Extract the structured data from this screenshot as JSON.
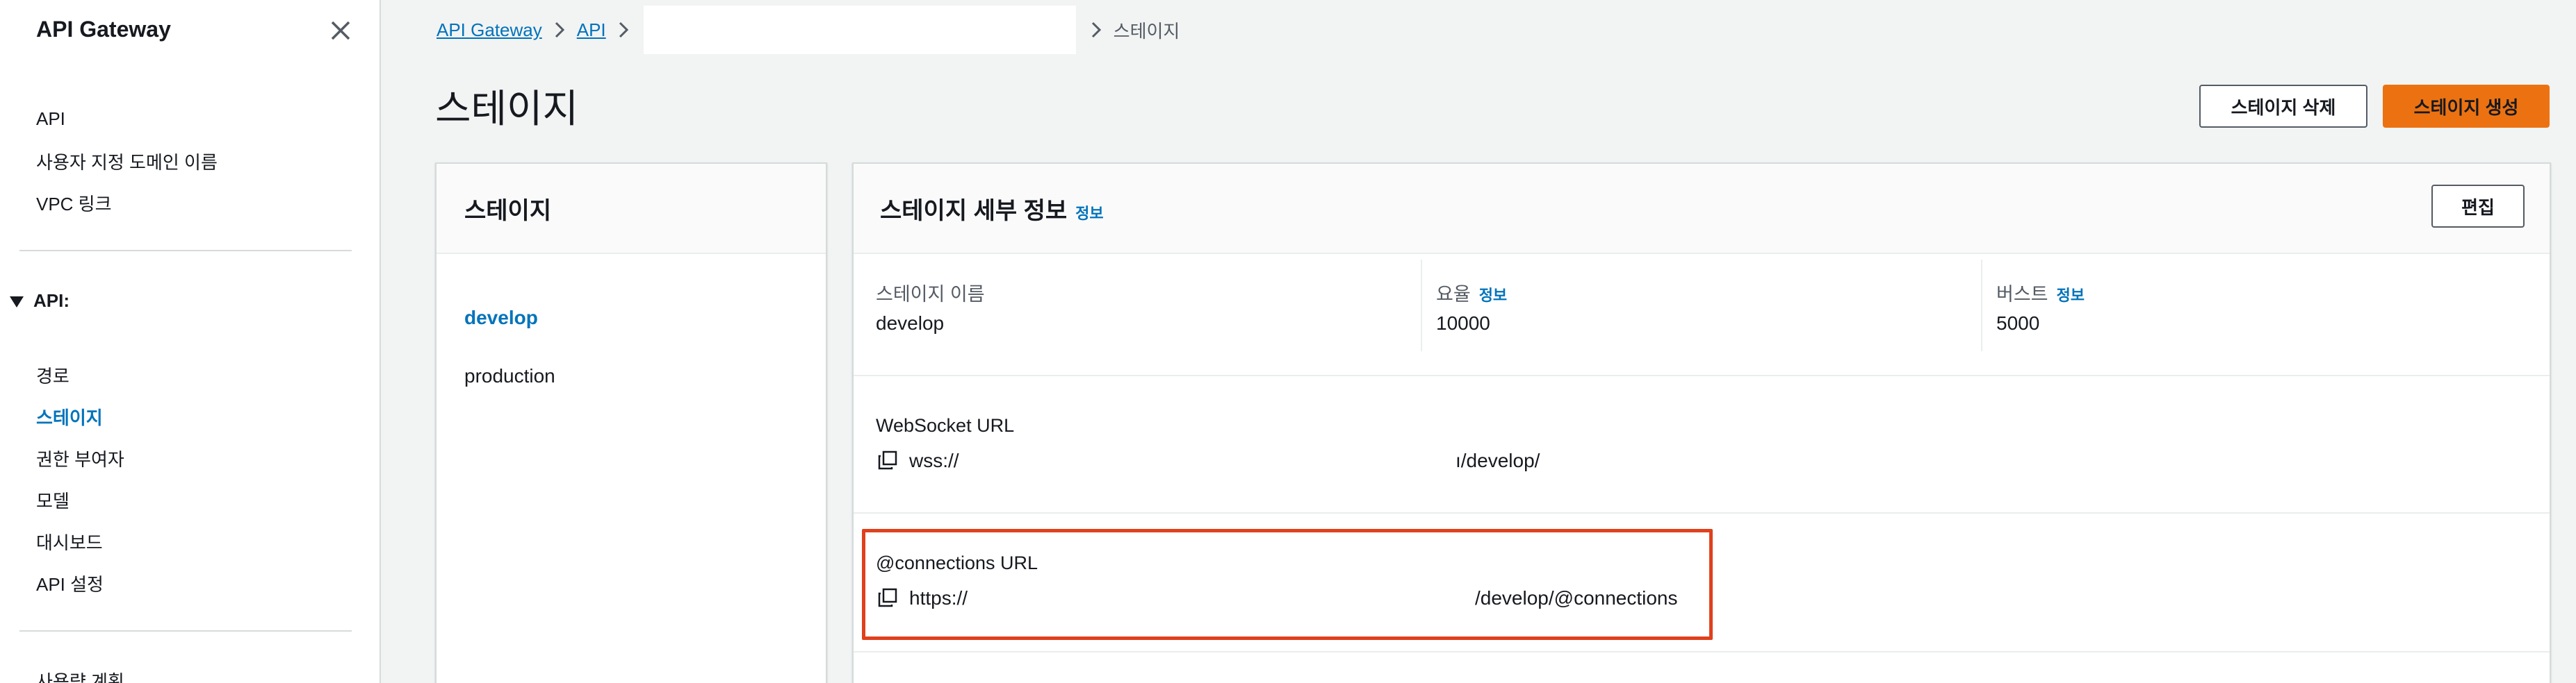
{
  "sidebar": {
    "title": "API Gateway",
    "top_links": [
      "API",
      "사용자 지정 도메인 이름",
      "VPC 링크"
    ],
    "section_label": "API:",
    "section_links": [
      "경로",
      "스테이지",
      "권한 부여자",
      "모델",
      "대시보드",
      "API 설정"
    ],
    "active_link": "스테이지",
    "cut_link": "사용량 계획"
  },
  "breadcrumb": {
    "items": [
      "API Gateway",
      "API"
    ],
    "current": "스테이지"
  },
  "page": {
    "title": "스테이지",
    "delete_button": "스테이지 삭제",
    "create_button": "스테이지 생성"
  },
  "stages_panel": {
    "title": "스테이지",
    "items": [
      "develop",
      "production"
    ],
    "selected": "develop"
  },
  "details_panel": {
    "title": "스테이지 세부 정보",
    "info": "정보",
    "edit_button": "편집",
    "stage_name_label": "스테이지 이름",
    "stage_name_value": "develop",
    "rate_label": "요율",
    "rate_value": "10000",
    "burst_label": "버스트",
    "burst_value": "5000",
    "websocket_label": "WebSocket URL",
    "websocket_prefix": "wss://",
    "websocket_suffix": "ı/develop/",
    "connections_label": "@connections URL",
    "connections_prefix": "https://",
    "connections_suffix": "/develop/@connections"
  },
  "colors": {
    "link": "#0073bb",
    "primary_button": "#ec7211",
    "highlight_border": "#e0401c"
  }
}
